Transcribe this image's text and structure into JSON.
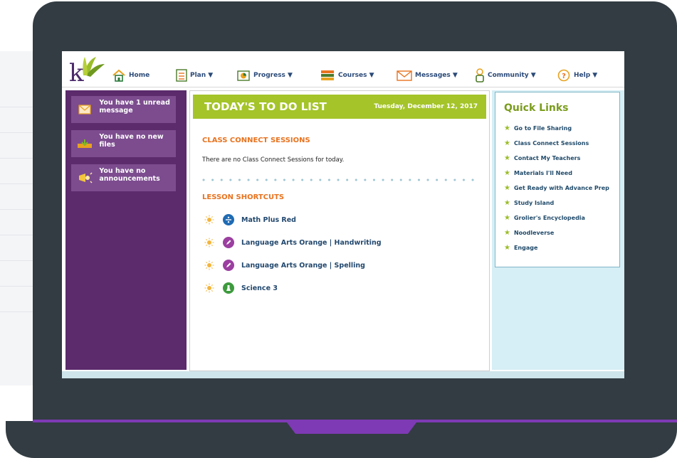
{
  "nav": {
    "home": "Home",
    "plan": "Plan ▼",
    "progress": "Progress ▼",
    "courses": "Courses ▼",
    "messages": "Messages ▼",
    "community": "Community ▼",
    "help": "Help ▼"
  },
  "notifications": [
    {
      "icon": "envelope-icon",
      "text": "You have 1 unread message"
    },
    {
      "icon": "files-tray-icon",
      "text": "You have no new files"
    },
    {
      "icon": "megaphone-icon",
      "text": "You have no announcements"
    }
  ],
  "todo": {
    "title": "TODAY'S TO DO LIST",
    "date": "Tuesday, December 12, 2017",
    "class_connect_title": "CLASS CONNECT SESSIONS",
    "class_connect_text": "There are no Class Connect Sessions for today.",
    "lesson_shortcuts_title": "LESSON SHORTCUTS",
    "lessons": [
      {
        "label": "Math Plus Red",
        "icon": "math-divide-icon",
        "color": "#1f6bb3"
      },
      {
        "label": "Language Arts Orange | Handwriting",
        "icon": "pencil-icon",
        "color": "#9b3fa0"
      },
      {
        "label": "Language Arts Orange | Spelling",
        "icon": "pencil-icon",
        "color": "#9b3fa0"
      },
      {
        "label": "Science 3",
        "icon": "science-icon",
        "color": "#3d9a3d"
      }
    ]
  },
  "quick_links": {
    "title": "Quick Links",
    "items": [
      "Go to File Sharing",
      "Class Connect Sessions",
      "Contact My Teachers",
      "Materials I'll Need",
      "Get Ready with Advance Prep",
      "Study Island",
      "Grolier's Encyclopedia",
      "Noodleverse",
      "Engage"
    ]
  },
  "colors": {
    "laptop_frame": "#323c42",
    "accent_purple": "#7e3ab5",
    "sidebar": "#5b2b6c",
    "todo_header": "#a4c429",
    "section_title": "#e8731f"
  }
}
